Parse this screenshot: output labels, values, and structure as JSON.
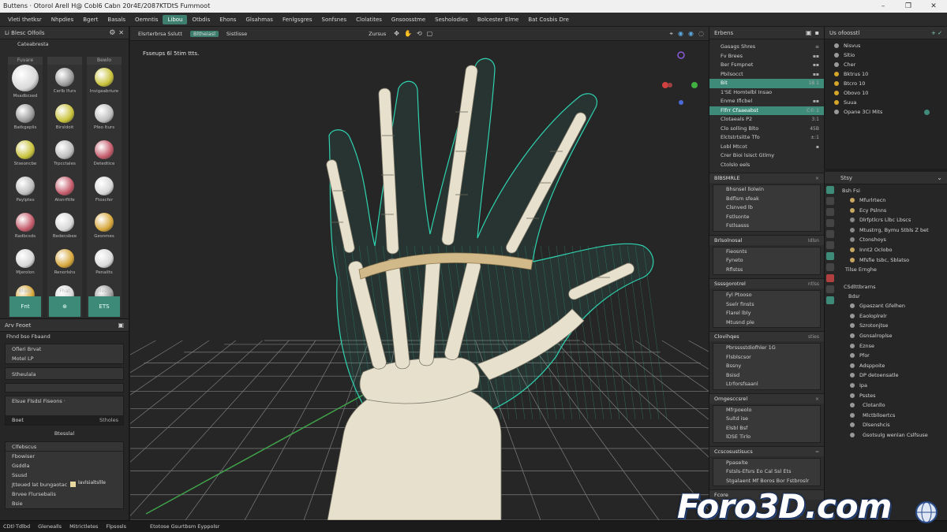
{
  "window": {
    "title": "Buttens · Otorol Arell H@ Cobl6 Cabn 20r4E/2087KTDtS Fummoot",
    "min": "–",
    "max": "❐",
    "close": "✕"
  },
  "menu": [
    "Vleti thetksr",
    "Nhpdies",
    "Bgert",
    "Basals",
    "Oemntis",
    "Libou",
    "Otbdis",
    "Ehons",
    "Glsahmas",
    "Fenlgsgres",
    "Sonfsnes",
    "Clolatites",
    "Gnsoosstme",
    "Sesholodies",
    "Bolcester Elme",
    "Bat Cosbis Dre"
  ],
  "menu_active_index": 5,
  "left_panel": {
    "title": "Li Blesc Olfoils",
    "subtitle": "Cateabresta",
    "columns": [
      {
        "header": "Fuvare",
        "items": [
          "Msadbcsed",
          "Batkgeplis",
          "Stseoncbe",
          "Paylptes",
          "Radbcsds",
          "Mjerolon",
          "Nulstes"
        ],
        "foot_label": "Bluos",
        "foot_btn": "Fnt"
      },
      {
        "header": "",
        "items": [
          "Cerlb Ifurs",
          "Birsldoit",
          "Trpcctales",
          "Atsnrftife",
          "Bedecsbee",
          "Renorlshs",
          "Hoechever"
        ],
        "foot_label": "Fhat",
        "foot_btn": "⊕"
      },
      {
        "header": "Bewlo",
        "items": [
          "Invigaabriure",
          "Pfeo Iturs",
          "Detedtice",
          "Ftoscfer",
          "Gesnmes",
          "Penailts",
          "Grodsles"
        ],
        "foot_label": "Slleshe",
        "foot_btn": "ETS"
      }
    ]
  },
  "left_props": {
    "header": "Arv Feoet",
    "rows1": [
      "Fhnd bso Fbaand"
    ],
    "box1": [
      "Ofleri Brvat",
      "Motel LP"
    ],
    "box2": [
      "Stheulala"
    ],
    "box3": [
      "Elsue Flsdsl Fiseons ·",
      "Boet",
      "Stholes"
    ],
    "mid": "Btesslal",
    "rows2": [
      "Clfebscus",
      "Fbowiser",
      "Gsddla",
      "Ssusd",
      "Jtteued lat bungaotac",
      "Brvee Flursebalis",
      "Bsie"
    ],
    "chip_label": "Iavlsialtsllle"
  },
  "viewport": {
    "toolbar": [
      "Elsrterbrsa Sslutt",
      "Bltheiasl",
      "Sistlisse",
      "Zursus"
    ],
    "overlay_text": "Fsseups 6l 5tim ttts."
  },
  "mid_panel": {
    "header": "Erbens",
    "rows_top": [
      {
        "label": "Gasags Shres",
        "r": "≡"
      },
      {
        "label": "Fv Brees",
        "r": "▪▪"
      },
      {
        "label": "Ber Fsmpnet",
        "r": "▪▪"
      },
      {
        "label": "Pbilsocct",
        "r": "▪▪"
      },
      {
        "label": "Bit",
        "r": "1B 1",
        "hl": true
      },
      {
        "label": "1'SE Homtelbl Insao",
        "r": ""
      },
      {
        "label": "Enme Iflcbel",
        "r": "▪▪"
      },
      {
        "label": "Flfrr Cfaaeabst",
        "r": "C© 1",
        "hl": true
      },
      {
        "label": "Clotaeals P2",
        "r": "3:1"
      },
      {
        "label": "Clo solling Blto",
        "r": "45B"
      },
      {
        "label": "Elctstrtsitte Tfo",
        "r": "±:1"
      },
      {
        "label": "Lobl Mtcot",
        "r": "▪"
      },
      {
        "label": "Crer Bioi lsisct Gtlmy",
        "r": ""
      },
      {
        "label": "Ctolslo eels",
        "r": ""
      }
    ],
    "sections": [
      {
        "title": "BlBSMRLE",
        "r": "×",
        "rows": [
          "Bhsnsel llolwin",
          "Bdflsm sfeak",
          "Clsnved lb",
          "Fstlsonte",
          "Fstlsasss"
        ]
      },
      {
        "title": "Brlsolnosal",
        "r": "Idlsn",
        "rows": [
          "Fieosnts",
          "Fyneto",
          "Rflstss"
        ]
      },
      {
        "title": "Ssssgorotrel",
        "r": "ntlss",
        "rows": [
          "Fyl Ptooso",
          "Sselr finsts",
          "Flarel lbly",
          "Mtusnd ple"
        ]
      },
      {
        "title": "Clovihqes",
        "r": "sties",
        "rows": [
          "Pbrsssstdiofhler 1G",
          "Flsblscsor",
          "Bssny",
          "Bsisd",
          "Ltrforsfsaanl"
        ]
      },
      {
        "title": "Orngesccsrel",
        "r": "×",
        "rows": [
          "Mfrpoeolo",
          "Sultd ise",
          "Elsbl Bsf",
          "lDSE Tirlo"
        ]
      },
      {
        "title": "Ccscosustisucs",
        "r": "=",
        "rows": [
          "Ppaselte",
          "Fstsls-Efsrs Eo Cal Ssl Ets",
          "Stgalaent Mf Boros Bor Fstbroslr"
        ]
      },
      {
        "title": "Fcore",
        "r": "",
        "rows": []
      }
    ]
  },
  "outliner": {
    "header": "Us ofoosstl",
    "header_r": "+ ✓",
    "rows": [
      {
        "label": "Nisvus",
        "c": "#9a9a9a"
      },
      {
        "label": "Sltio",
        "c": "#9a9a9a"
      },
      {
        "label": "Cher",
        "c": "#9a9a9a"
      },
      {
        "label": "Bktrus 10",
        "c": "#d4a62a"
      },
      {
        "label": "Btcro 10",
        "c": "#d4a62a"
      },
      {
        "label": "Obovo 10",
        "c": "#d4a62a"
      },
      {
        "label": "Suua",
        "c": "#d4a62a"
      },
      {
        "label": "Opane 3CI Mits",
        "c": "#9a9a9a"
      }
    ]
  },
  "right_props": {
    "header": "Stsy",
    "sub": "Bsh   Fsi",
    "rows1": [
      "Mfurlrtecn",
      "Ecy Pslnns",
      "Dlrfptlcrs Llbc Lbscs",
      "Mtustrrg, Bymu Stbls Z bet",
      "Ctonshoys",
      "Innt2 Oclobo",
      "Mfsfie tsbc, Sblatso"
    ],
    "rows1_prefix": "Tilse   Ernghe",
    "group2": "CSdlttbrarns",
    "group2_sub": "Bdsr",
    "rows2": [
      "Gpaszant Gfelhen",
      "Eaoloplrelr",
      "Szrotonjtse",
      "Gsnsalroplse",
      "Eznse",
      "Pfor",
      "Adsppoite",
      "DP detoensatle",
      "Ipa",
      "Psstes",
      "Clotanllo",
      "Mlctblloertcs",
      "Dlsenshcis",
      "Gsotsulg wenlan Cslfsuse"
    ]
  },
  "status": [
    "CDtl·Tdlbd",
    "Glenealls",
    "Mitrictletes",
    "Flpsosls",
    "Etotose Gsurtbsm Eyppolsr"
  ],
  "watermark": "Foro3D.com",
  "colors": {
    "accent": "#3f8b79",
    "wire": "#2fd3b0",
    "bone": "#e7e1cf",
    "grid": "#8a8a8a"
  }
}
